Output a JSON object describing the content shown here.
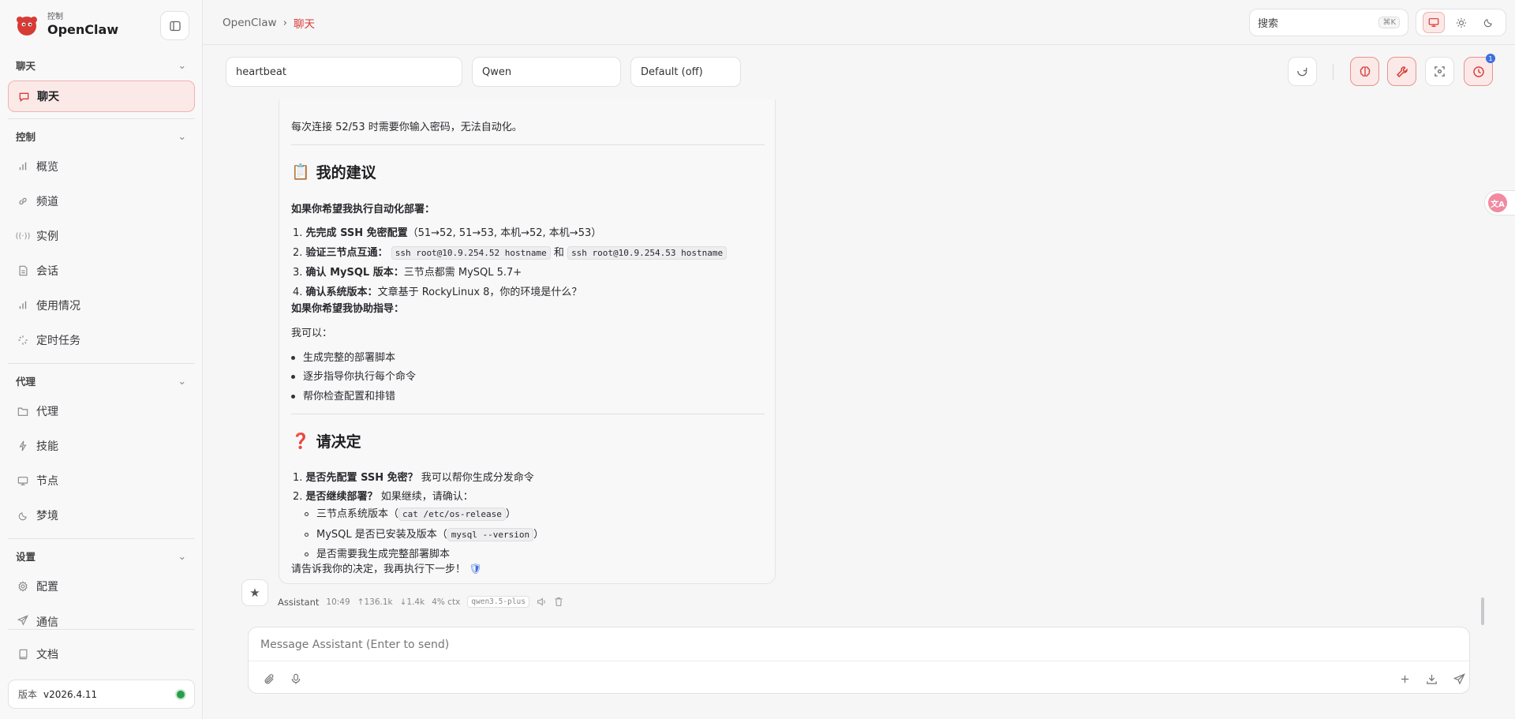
{
  "brand": {
    "sub": "控制",
    "title": "OpenClaw"
  },
  "sidebar": {
    "sections": [
      {
        "label": "聊天"
      },
      {
        "label": "控制"
      },
      {
        "label": "代理"
      },
      {
        "label": "设置"
      }
    ],
    "items": [
      {
        "label": "聊天",
        "icon": "chat-bubble-icon"
      },
      {
        "label": "概览",
        "icon": "bar-chart-icon"
      },
      {
        "label": "频道",
        "icon": "link-icon"
      },
      {
        "label": "实例",
        "icon": "broadcast-icon"
      },
      {
        "label": "会话",
        "icon": "document-icon"
      },
      {
        "label": "使用情况",
        "icon": "bar-chart-icon"
      },
      {
        "label": "定时任务",
        "icon": "loader-icon"
      },
      {
        "label": "代理",
        "icon": "folder-icon"
      },
      {
        "label": "技能",
        "icon": "lightning-icon"
      },
      {
        "label": "节点",
        "icon": "monitor-icon"
      },
      {
        "label": "梦境",
        "icon": "moon-icon"
      },
      {
        "label": "配置",
        "icon": "gear-icon"
      },
      {
        "label": "通信",
        "icon": "send-icon"
      },
      {
        "label": "文档",
        "icon": "book-icon"
      }
    ],
    "version_label": "版本",
    "version_value": "v2026.4.11"
  },
  "topbar": {
    "breadcrumb_root": "OpenClaw",
    "breadcrumb_sep": "›",
    "breadcrumb_current": "聊天",
    "search_label": "搜索",
    "search_shortcut": "⌘K"
  },
  "filters": {
    "session": "heartbeat",
    "model": "Qwen",
    "thinking": "Default (off)"
  },
  "message": {
    "intro": "每次连接 52/53 时需要你输入密码，无法自动化。",
    "h_suggest": "我的建议",
    "h_suggest_emoji": "📋",
    "auto_title": "如果你希望我执行自动化部署：",
    "steps": [
      {
        "n": "1.",
        "b": "先完成 SSH 免密配置",
        "t": "（51→52, 51→53, 本机→52, 本机→53）"
      },
      {
        "n": "2.",
        "b": "验证三节点互通：",
        "c1": "ssh root@10.9.254.52 hostname",
        "mid": "和",
        "c2": "ssh root@10.9.254.53 hostname"
      },
      {
        "n": "3.",
        "b": "确认 MySQL 版本：",
        "t": "三节点都需 MySQL 5.7+"
      },
      {
        "n": "4.",
        "b": "确认系统版本：",
        "t": "文章基于 RockyLinux 8，你的环境是什么？"
      }
    ],
    "guide_title": "如果你希望我协助指导：",
    "can_do": "我可以：",
    "bullets": [
      "生成完整的部署脚本",
      "逐步指导你执行每个命令",
      "帮你检查配置和排错"
    ],
    "h_decide": "请决定",
    "h_decide_emoji": "❓",
    "d1_n": "1.",
    "d1_b": "是否先配置 SSH 免密？",
    "d1_t": "我可以帮你生成分发命令",
    "d2_n": "2.",
    "d2_b": "是否继续部署？",
    "d2_t": "如果继续，请确认：",
    "sub1_a": "三节点系统版本（",
    "sub1_code": "cat /etc/os-release",
    "sub1_b": "）",
    "sub2_a": "MySQL 是否已安装及版本（",
    "sub2_code": "mysql --version",
    "sub2_b": "）",
    "sub3": "是否需要我生成完整部署脚本",
    "closing": "请告诉我你的决定，我再执行下一步！",
    "closing_emoji": "🛡"
  },
  "meta": {
    "sender": "Assistant",
    "time": "10:49",
    "up": "↑136.1k",
    "down": "↓1.4k",
    "ctx": "4% ctx",
    "model": "qwen3.5-plus"
  },
  "composer": {
    "placeholder": "Message Assistant (Enter to send)"
  },
  "badge_count": "1",
  "colors": {
    "accent": "#d83b34",
    "status_ok": "#2a9d4b"
  }
}
